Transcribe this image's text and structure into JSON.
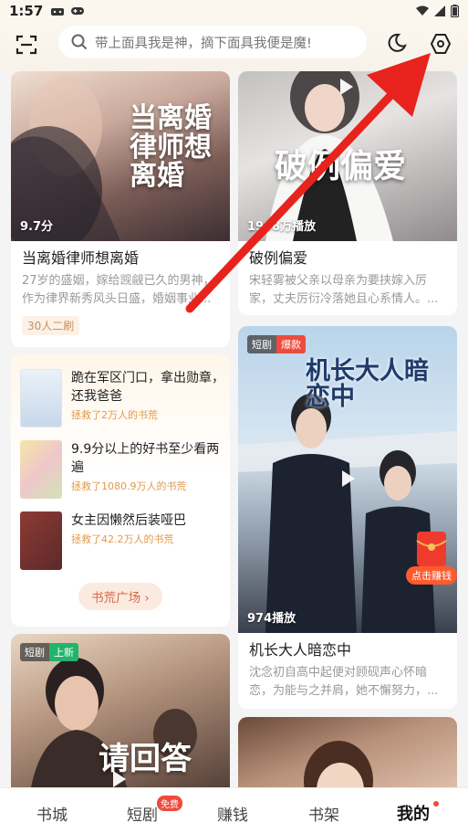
{
  "status_bar": {
    "time": "1:57"
  },
  "header": {
    "search_placeholder": "带上面具我是神，摘下面具我便是魔!"
  },
  "feed": {
    "left": [
      {
        "cover_title": "当离婚律师想离婚",
        "overlay": "9.7分",
        "title": "当离婚律师想离婚",
        "desc": "27岁的盛姻，嫁给觊觎已久的男神，作为律界新秀风头日盛，婚姻事业...",
        "tag": "30人二刷"
      },
      {
        "badge_a": "短剧",
        "badge_b": "上新",
        "cover_title": "请回答"
      }
    ],
    "right": [
      {
        "cover_title": "破例偏爱",
        "overlay": "1908万播放",
        "title": "破例偏爱",
        "desc": "宋轻雾被父亲以母亲为要挟嫁入厉家，丈夫厉衍冷落她且心系情人。..."
      },
      {
        "badge_a": "短剧",
        "badge_b": "爆款",
        "cover_title": "机长大人暗恋中",
        "overlay": "974播放",
        "title": "机长大人暗恋中",
        "desc": "沈念初自高中起便对顾砚声心怀暗恋，为能与之并肩，她不懈努力，..."
      },
      {}
    ]
  },
  "recommend": {
    "items": [
      {
        "title": "跪在军区门口，拿出勋章，还我爸爸",
        "sub": "拯救了2万人的书荒"
      },
      {
        "title": "9.9分以上的好书至少看两遍",
        "sub": "拯救了1080.9万人的书荒"
      },
      {
        "title": "女主因懒然后装哑巴",
        "sub": "拯救了42.2万人的书荒"
      }
    ],
    "plaza_button": "书荒广场 ›"
  },
  "red_packet": {
    "label": "点击赚钱"
  },
  "bottom_nav": {
    "items": [
      "书城",
      "短剧",
      "赚钱",
      "书架",
      "我的"
    ],
    "active": "我的",
    "badge": "免费"
  },
  "colors": {
    "accent": "#f04a3c",
    "annotation_arrow": "#e8231d"
  }
}
